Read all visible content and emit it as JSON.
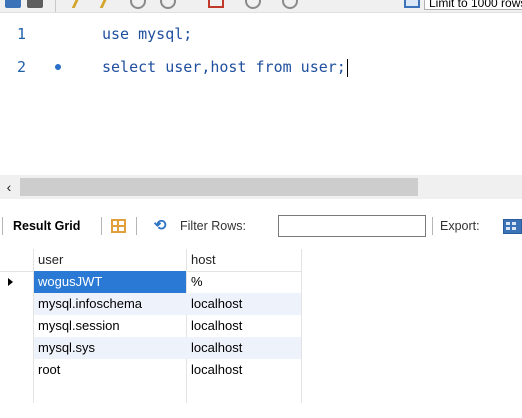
{
  "toolbar": {
    "limit_label": "Limit to 1000 rows"
  },
  "editor": {
    "lines": [
      {
        "number": "1",
        "code": "use mysql;",
        "has_marker": false
      },
      {
        "number": "2",
        "code": "select user,host from user;",
        "has_marker": true
      }
    ]
  },
  "result_toolbar": {
    "result_grid_label": "Result Grid",
    "filter_rows_label": "Filter Rows:",
    "filter_value": "",
    "export_label": "Export:"
  },
  "grid": {
    "columns": [
      "user",
      "host"
    ],
    "rows": [
      {
        "user": "wogusJWT",
        "host": "%",
        "selected": true
      },
      {
        "user": "mysql.infoschema",
        "host": "localhost"
      },
      {
        "user": "mysql.session",
        "host": "localhost"
      },
      {
        "user": "mysql.sys",
        "host": "localhost"
      },
      {
        "user": "root",
        "host": "localhost"
      }
    ]
  },
  "colors": {
    "selection": "#2a7ad5",
    "row_alt": "#eef2fb",
    "keyword": "#1f4f9e"
  }
}
